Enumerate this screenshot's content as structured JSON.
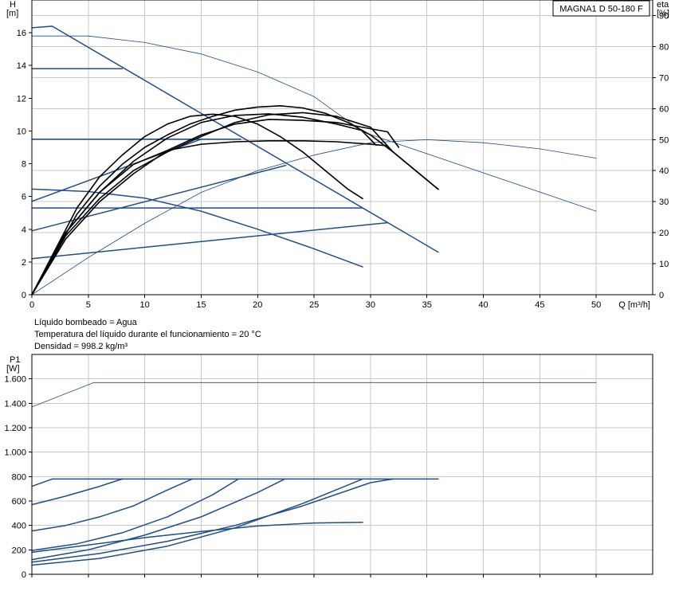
{
  "model_label": "MAGNA1 D 50-180 F",
  "info_lines": [
    "Líquido bombeado = Agua",
    "Temperatura del líquido durante el funcionamiento = 20 °C",
    "Densidad = 998.2 kg/m³"
  ],
  "chart_data": [
    {
      "type": "line",
      "title": "",
      "xlabel": "Q [m³/h]",
      "ylabel": "H\n[m]",
      "y2label": "eta\n[%]",
      "xlim": [
        0,
        55
      ],
      "ylim": [
        0,
        18
      ],
      "y2lim": [
        0,
        95
      ],
      "xticks": [
        0,
        5,
        10,
        15,
        20,
        25,
        30,
        35,
        40,
        45,
        50
      ],
      "yticks": [
        0,
        2,
        4,
        6,
        8,
        10,
        12,
        14,
        16
      ],
      "y2ticks": [
        0,
        10,
        20,
        30,
        40,
        50,
        60,
        70,
        80,
        90
      ],
      "grid": true,
      "series": [
        {
          "group": "system",
          "axis": "left",
          "color": "#1f4e8c",
          "width": 1.5,
          "x": [
            0,
            1.8,
            36
          ],
          "y": [
            16.3,
            16.4,
            2.6
          ]
        },
        {
          "group": "system",
          "axis": "left",
          "color": "#1f4e8c",
          "width": 1.5,
          "x": [
            0,
            8
          ],
          "y": [
            13.8,
            13.8
          ]
        },
        {
          "group": "system",
          "axis": "left",
          "color": "#1f4e8c",
          "width": 1.5,
          "x": [
            0,
            18.5
          ],
          "y": [
            9.5,
            9.5
          ]
        },
        {
          "group": "system",
          "axis": "left",
          "color": "#1f4e8c",
          "width": 1.5,
          "x": [
            0,
            29.3
          ],
          "y": [
            5.3,
            5.3
          ]
        },
        {
          "group": "system",
          "axis": "left",
          "color": "#1f4e8c",
          "width": 1.5,
          "x": [
            0,
            15
          ],
          "y": [
            5.7,
            9.5
          ]
        },
        {
          "group": "system",
          "axis": "left",
          "color": "#1f4e8c",
          "width": 1.5,
          "x": [
            0,
            22.5
          ],
          "y": [
            3.9,
            7.9
          ]
        },
        {
          "group": "system",
          "axis": "left",
          "color": "#1f4e8c",
          "width": 1.5,
          "x": [
            0,
            31.5
          ],
          "y": [
            2.2,
            4.4
          ]
        },
        {
          "group": "pump_min",
          "axis": "left",
          "color": "#1f4e8c",
          "width": 1.5,
          "x": [
            0,
            5,
            10,
            15,
            20,
            25,
            29.3
          ],
          "y": [
            6.45,
            6.3,
            5.9,
            5.1,
            4.0,
            2.8,
            1.7
          ]
        },
        {
          "group": "pump_max_thin",
          "axis": "left",
          "color": "#1f4e8c",
          "width": 0.8,
          "x": [
            0,
            5,
            10,
            15,
            20,
            25,
            27,
            29.5,
            50
          ],
          "y": [
            15.8,
            15.8,
            15.4,
            14.7,
            13.6,
            12.1,
            11.1,
            9.9,
            5.1
          ]
        },
        {
          "group": "eta_max",
          "axis": "right",
          "color": "#1f4e8c",
          "width": 0.8,
          "x": [
            0,
            5,
            10,
            15,
            20,
            25,
            30,
            35,
            40,
            45,
            50
          ],
          "y": [
            0,
            12,
            23,
            33,
            40,
            45,
            49,
            50,
            49,
            47,
            44
          ]
        },
        {
          "group": "eta",
          "axis": "right",
          "color": "#000000",
          "width": 1.6,
          "x": [
            0,
            2,
            4,
            6,
            8,
            10,
            12,
            14,
            16,
            18,
            20,
            22,
            24,
            26,
            28,
            29.3
          ],
          "y": [
            0,
            14,
            28,
            38,
            45,
            51,
            55,
            57.5,
            58.2,
            57.5,
            55,
            51,
            46,
            40,
            34,
            31
          ]
        },
        {
          "group": "eta",
          "axis": "right",
          "color": "#000000",
          "width": 1.6,
          "x": [
            0,
            2,
            4,
            6,
            8,
            10,
            12,
            14,
            16,
            18,
            20,
            22,
            24,
            26,
            28,
            30,
            32,
            34,
            36
          ],
          "y": [
            0,
            13,
            26,
            35,
            42,
            47.5,
            51.5,
            55,
            57.5,
            59.5,
            60.5,
            60.9,
            60.2,
            58.5,
            55.5,
            51.5,
            46,
            40,
            34
          ]
        },
        {
          "group": "eta",
          "axis": "right",
          "color": "#000000",
          "width": 1.6,
          "x": [
            0,
            3,
            6,
            9,
            12,
            15,
            18,
            21,
            24,
            27,
            30,
            31.5
          ],
          "y": [
            0,
            20,
            33,
            42,
            46.5,
            48.5,
            49.3,
            49.6,
            49.6,
            49.3,
            48.5,
            48
          ]
        },
        {
          "group": "eta",
          "axis": "right",
          "color": "#000000",
          "width": 1.6,
          "x": [
            0,
            3,
            6,
            9,
            12,
            15,
            18,
            21,
            24,
            27,
            29.2,
            30.5
          ],
          "y": [
            0,
            20,
            33,
            43,
            50.5,
            55.5,
            57.8,
            58.3,
            57.2,
            55,
            53,
            48.2
          ]
        },
        {
          "group": "eta",
          "axis": "right",
          "color": "#000000",
          "width": 1.6,
          "x": [
            0,
            3,
            6,
            9,
            12,
            15,
            18,
            21,
            24,
            27,
            30,
            32,
            34,
            36
          ],
          "y": [
            0,
            19,
            31,
            40,
            46,
            51,
            55.5,
            58,
            58.7,
            57.5,
            54,
            46,
            40,
            34
          ]
        },
        {
          "group": "eta",
          "axis": "right",
          "color": "#000000",
          "width": 1.6,
          "x": [
            0,
            3,
            6,
            9,
            12,
            15,
            18,
            21,
            24,
            27,
            30,
            31.5,
            32.5
          ],
          "y": [
            0,
            18,
            30,
            39,
            46.5,
            51.5,
            55,
            56.5,
            56.2,
            55.5,
            53.5,
            52.5,
            47.5
          ]
        }
      ]
    },
    {
      "type": "line",
      "title": "",
      "xlabel": "",
      "ylabel": "P1\n[W]",
      "xlim": [
        0,
        55
      ],
      "ylim": [
        0,
        1800
      ],
      "xticks": [
        0,
        5,
        10,
        15,
        20,
        25,
        30,
        35,
        40,
        45,
        50
      ],
      "yticks": [
        0,
        200,
        400,
        600,
        800,
        1000,
        1200,
        1400,
        1600
      ],
      "ytick_labels": [
        "0",
        "200",
        "400",
        "600",
        "800",
        "1.000",
        "1.200",
        "1.400",
        "1.600"
      ],
      "grid": true,
      "series": [
        {
          "axis": "left",
          "color": "#1f4e8c",
          "width": 0.8,
          "x": [
            0,
            5.5,
            50
          ],
          "y": [
            1370,
            1570,
            1570
          ]
        },
        {
          "axis": "left",
          "color": "#1f4e8c",
          "width": 1.5,
          "x": [
            0,
            1.8,
            36
          ],
          "y": [
            720,
            780,
            780
          ]
        },
        {
          "axis": "left",
          "color": "#1f4e8c",
          "width": 1.5,
          "x": [
            0,
            3,
            6,
            8
          ],
          "y": [
            570,
            640,
            720,
            780
          ]
        },
        {
          "axis": "left",
          "color": "#1f4e8c",
          "width": 1.5,
          "x": [
            0,
            3,
            6,
            9,
            12,
            14.2
          ],
          "y": [
            355,
            400,
            470,
            560,
            690,
            780
          ]
        },
        {
          "axis": "left",
          "color": "#1f4e8c",
          "width": 1.5,
          "x": [
            0,
            4,
            8,
            12,
            16,
            18.3
          ],
          "y": [
            195,
            250,
            340,
            470,
            650,
            780
          ]
        },
        {
          "axis": "left",
          "color": "#1f4e8c",
          "width": 1.5,
          "x": [
            0,
            5,
            10,
            15,
            20,
            22.4
          ],
          "y": [
            120,
            200,
            320,
            470,
            670,
            780
          ]
        },
        {
          "axis": "left",
          "color": "#1f4e8c",
          "width": 1.5,
          "x": [
            0,
            6,
            12,
            18,
            24,
            29.3
          ],
          "y": [
            75,
            130,
            230,
            380,
            580,
            780
          ]
        },
        {
          "axis": "left",
          "color": "#1f4e8c",
          "width": 1.5,
          "x": [
            0,
            6,
            12,
            18,
            24,
            30,
            32
          ],
          "y": [
            100,
            170,
            270,
            400,
            560,
            750,
            780
          ]
        },
        {
          "axis": "left",
          "color": "#1f4e8c",
          "width": 1.5,
          "x": [
            0,
            5,
            10,
            15,
            20,
            25,
            29.3
          ],
          "y": [
            180,
            240,
            300,
            350,
            395,
            420,
            425
          ]
        }
      ]
    }
  ]
}
